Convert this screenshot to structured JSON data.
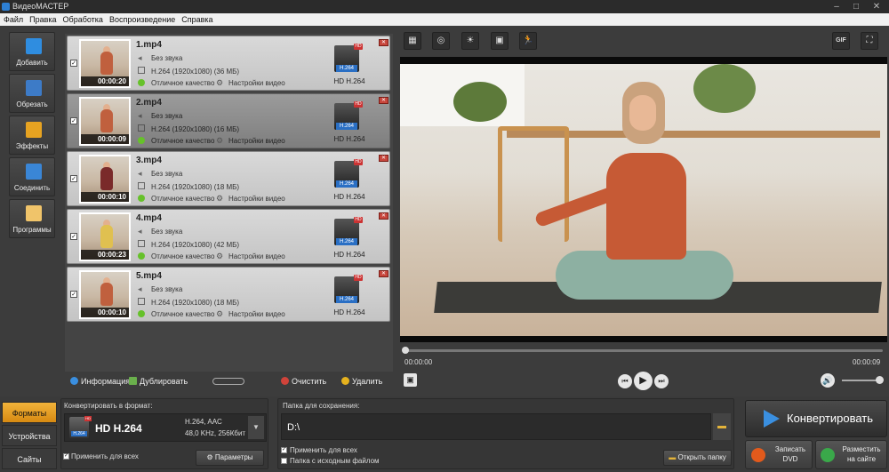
{
  "app": {
    "title": "ВидеоМАСТЕР"
  },
  "menu": [
    "Файл",
    "Правка",
    "Обработка",
    "Воспроизведение",
    "Справка"
  ],
  "sidebar": [
    {
      "label": "Добавить",
      "icon": "film-add-icon"
    },
    {
      "label": "Обрезать",
      "icon": "film-cut-icon"
    },
    {
      "label": "Эффекты",
      "icon": "sparkle-icon"
    },
    {
      "label": "Соединить",
      "icon": "film-join-icon"
    },
    {
      "label": "Программы",
      "icon": "tag-icon"
    }
  ],
  "files": [
    {
      "name": "1.mp4",
      "audio": "Без звука",
      "codec": "H.264 (1920x1080) (36 МБ)",
      "quality": "Отличное качество",
      "settings": "Настройки видео",
      "duration": "00:00:20",
      "format": "HD H.264",
      "checked": true,
      "selected": false
    },
    {
      "name": "2.mp4",
      "audio": "Без звука",
      "codec": "H.264 (1920x1080) (16 МБ)",
      "quality": "Отличное качество",
      "settings": "Настройки видео",
      "duration": "00:00:09",
      "format": "HD H.264",
      "checked": true,
      "selected": true
    },
    {
      "name": "3.mp4",
      "audio": "Без звука",
      "codec": "H.264 (1920x1080) (18 МБ)",
      "quality": "Отличное качество",
      "settings": "Настройки видео",
      "duration": "00:00:10",
      "format": "HD H.264",
      "checked": true,
      "selected": false
    },
    {
      "name": "4.mp4",
      "audio": "Без звука",
      "codec": "H.264 (1920x1080) (42 МБ)",
      "quality": "Отличное качество",
      "settings": "Настройки видео",
      "duration": "00:00:23",
      "format": "HD H.264",
      "checked": true,
      "selected": false
    },
    {
      "name": "5.mp4",
      "audio": "Без звука",
      "codec": "H.264 (1920x1080) (18 МБ)",
      "quality": "Отличное качество",
      "settings": "Настройки видео",
      "duration": "00:00:10",
      "format": "HD H.264",
      "checked": true,
      "selected": false
    }
  ],
  "format_badge": {
    "codec_tag": "H.264",
    "hd_tag": "HD"
  },
  "listtools": {
    "info": "Информация",
    "duplicate": "Дублировать",
    "clear": "Очистить",
    "delete": "Удалить"
  },
  "preview": {
    "gif": "GIF",
    "time_start": "00:00:00",
    "time_end": "00:00:09",
    "progress": 0.0
  },
  "bottom": {
    "tabs": [
      "Форматы",
      "Устройства",
      "Сайты"
    ],
    "convert_label": "Конвертировать в формат:",
    "format_name": "HD H.264",
    "format_spec1": "H.264, AAC",
    "format_spec2": "48,0 KHz, 256Кбит",
    "apply_all": "Применить для всех",
    "params": "Параметры",
    "save_label": "Папка для сохранения:",
    "save_path": "D:\\",
    "apply_all2": "Применить для всех",
    "source_folder": "Папка с исходным файлом",
    "open_folder": "Открыть папку",
    "convert_btn": "Конвертировать",
    "burn_dvd_1": "Записать",
    "burn_dvd_2": "DVD",
    "publish_1": "Разместить",
    "publish_2": "на сайте"
  }
}
